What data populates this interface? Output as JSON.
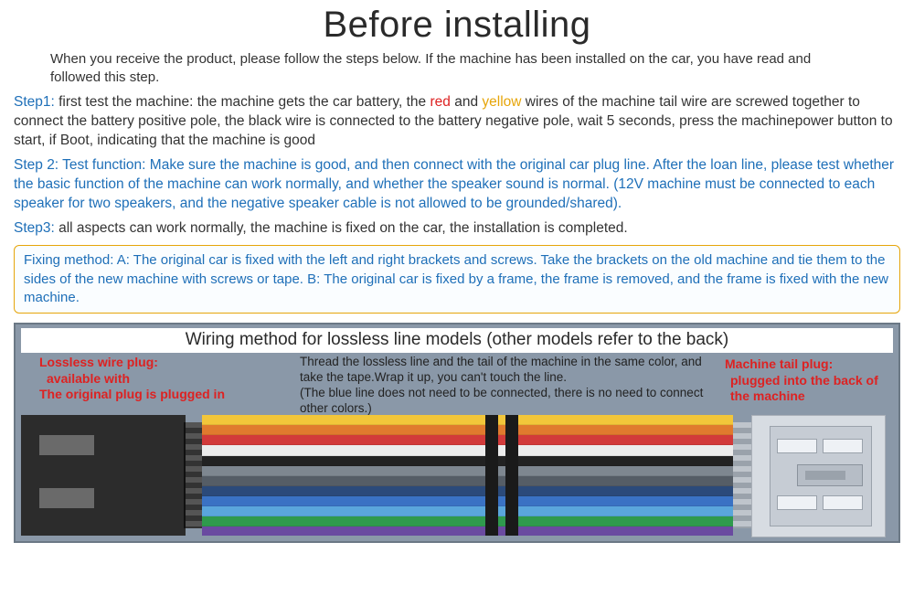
{
  "title": "Before installing",
  "intro": "When you receive the product, please follow the steps below. If the machine has been installed on the car, you have read and followed this step.",
  "step1": {
    "label": "Step1:",
    "a": " first test the machine: the machine gets the car battery, the ",
    "red": "red",
    "b": " and ",
    "yellow": "yellow",
    "c": " wires of the machine tail wire are screwed together to connect the battery positive pole, the black wire is connected to the battery negative pole, wait 5 seconds, press the machinepower button to start, if Boot, indicating that the machine is good"
  },
  "step2": {
    "label": "Step 2:",
    "text": " Test function: Make sure the machine is good, and then connect with the original car plug line. After the loan line, please test whether the basic function of the machine can work normally, and whether the speaker sound is normal. (12V machine must be connected to each speaker for two speakers, and the negative speaker cable is not allowed to be grounded/shared)."
  },
  "step3": {
    "label": "Step3:",
    "text": " all aspects can work normally, the machine is fixed on the car, the installation is completed."
  },
  "fixing": "Fixing method: A: The original car is fixed with the left and right brackets and screws. Take the brackets on the old machine and tie them to the sides of the new machine with screws or tape. B: The original car is fixed by a frame, the frame is removed, and the frame is fixed with the new machine.",
  "wiring": {
    "title": "Wiring method for lossless line models (other models refer to the back)",
    "left_note_a": "Lossless wire plug:",
    "left_note_b": "available with",
    "left_note_c": "The original plug is plugged in",
    "center_note_a": "Thread the lossless line and the tail of the machine in the same color, and take the tape.Wrap it up, you can't touch the line.",
    "center_note_b": "  (The blue line does not need to be connected, there is no need to connect other colors.)",
    "right_note_a": "Machine tail plug:",
    "right_note_b": "plugged into the back of the machine"
  },
  "wire_colors": [
    "yellow",
    "orange",
    "red",
    "white",
    "black",
    "gray",
    "dgray",
    "dblue",
    "blue",
    "lblue",
    "green",
    "purple"
  ]
}
